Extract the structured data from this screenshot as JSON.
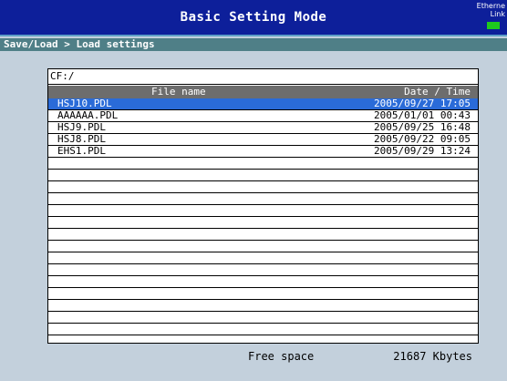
{
  "window": {
    "title": "Basic Setting Mode",
    "ethernet_label_1": "Etherne",
    "ethernet_label_2": "Link"
  },
  "breadcrumb": "Save/Load > Load settings",
  "colors": {
    "title_bar": "#0d1f9a",
    "breadcrumb_bar": "#4f7f87",
    "selection": "#2a6bd8",
    "header": "#6d6d6d",
    "link_led": "#1ec81e",
    "background": "#c3d0dc"
  },
  "file_list": {
    "path": "CF:/",
    "columns": {
      "name": "File name",
      "date": "Date / Time"
    },
    "rows": [
      {
        "name": "HSJ10.PDL",
        "date": "2005/09/27 17:05",
        "selected": true
      },
      {
        "name": "AAAAAA.PDL",
        "date": "2005/01/01 00:43",
        "selected": false
      },
      {
        "name": "HSJ9.PDL",
        "date": "2005/09/25 16:48",
        "selected": false
      },
      {
        "name": "HSJ8.PDL",
        "date": "2005/09/22 09:05",
        "selected": false
      },
      {
        "name": "EHS1.PDL",
        "date": "2005/09/29 13:24",
        "selected": false
      },
      {
        "name": "",
        "date": "",
        "selected": false
      },
      {
        "name": "",
        "date": "",
        "selected": false
      },
      {
        "name": "",
        "date": "",
        "selected": false
      },
      {
        "name": "",
        "date": "",
        "selected": false
      },
      {
        "name": "",
        "date": "",
        "selected": false
      },
      {
        "name": "",
        "date": "",
        "selected": false
      },
      {
        "name": "",
        "date": "",
        "selected": false
      },
      {
        "name": "",
        "date": "",
        "selected": false
      },
      {
        "name": "",
        "date": "",
        "selected": false
      },
      {
        "name": "",
        "date": "",
        "selected": false
      },
      {
        "name": "",
        "date": "",
        "selected": false
      },
      {
        "name": "",
        "date": "",
        "selected": false
      },
      {
        "name": "",
        "date": "",
        "selected": false
      },
      {
        "name": "",
        "date": "",
        "selected": false
      },
      {
        "name": "",
        "date": "",
        "selected": false
      }
    ]
  },
  "footer": {
    "free_space_label": "Free space",
    "free_space_value": "21687 Kbytes"
  }
}
